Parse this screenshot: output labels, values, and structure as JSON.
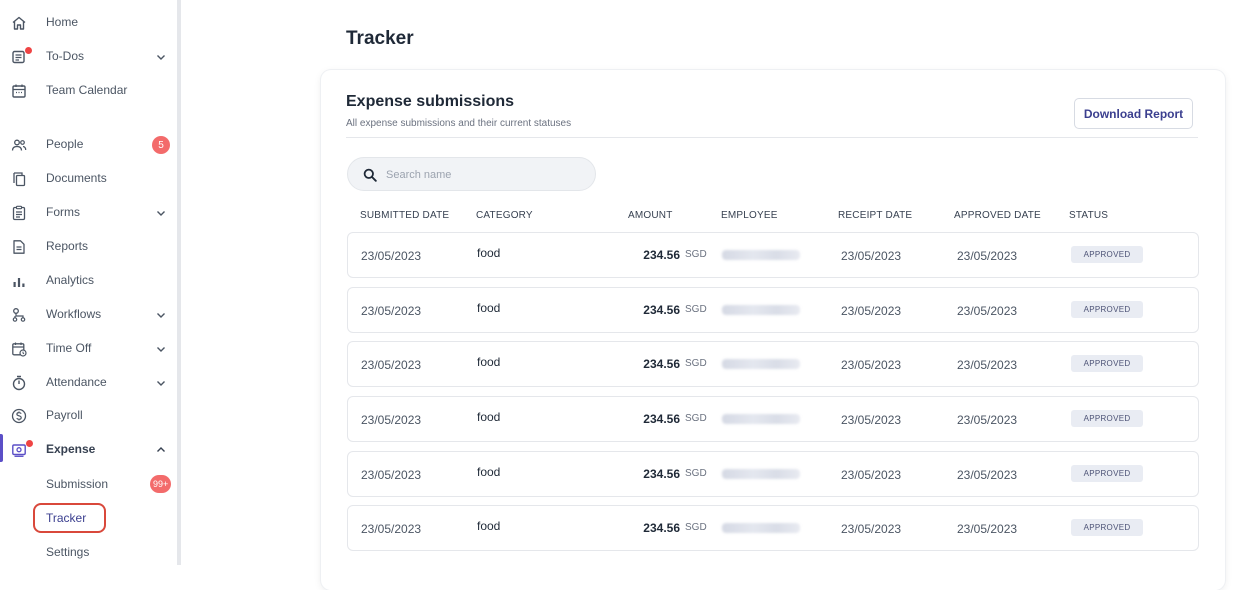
{
  "sidebar": {
    "items": [
      {
        "label": "Home",
        "icon": "home-icon"
      },
      {
        "label": "To-Dos",
        "icon": "todo-icon"
      },
      {
        "label": "Team Calendar",
        "icon": "calendar-icon"
      },
      {
        "label": "People",
        "icon": "people-icon",
        "badge": "5"
      },
      {
        "label": "Documents",
        "icon": "documents-icon"
      },
      {
        "label": "Forms",
        "icon": "forms-icon"
      },
      {
        "label": "Reports",
        "icon": "reports-icon"
      },
      {
        "label": "Analytics",
        "icon": "analytics-icon"
      },
      {
        "label": "Workflows",
        "icon": "workflows-icon"
      },
      {
        "label": "Time Off",
        "icon": "time-off-icon"
      },
      {
        "label": "Attendance",
        "icon": "stopwatch-icon"
      },
      {
        "label": "Payroll",
        "icon": "dollar-icon"
      },
      {
        "label": "Expense",
        "icon": "expense-icon"
      }
    ],
    "expense_sub": {
      "submission": "Submission",
      "submission_badge": "99+",
      "tracker": "Tracker",
      "settings": "Settings"
    }
  },
  "page": {
    "title": "Tracker"
  },
  "card": {
    "title": "Expense submissions",
    "subtitle": "All expense submissions and their current statuses",
    "download_label": "Download Report"
  },
  "search": {
    "placeholder": "Search name"
  },
  "table": {
    "headers": {
      "submitted_date": "SUBMITTED DATE",
      "category": "CATEGORY",
      "amount": "AMOUNT",
      "employee": "EMPLOYEE",
      "receipt_date": "RECEIPT DATE",
      "approved_date": "APPROVED DATE",
      "status": "STATUS"
    },
    "rows": [
      {
        "submitted": "23/05/2023",
        "category": "food",
        "amount": "234.56",
        "currency": "SGD",
        "receipt": "23/05/2023",
        "approved": "23/05/2023",
        "status": "APPROVED"
      },
      {
        "submitted": "23/05/2023",
        "category": "food",
        "amount": "234.56",
        "currency": "SGD",
        "receipt": "23/05/2023",
        "approved": "23/05/2023",
        "status": "APPROVED"
      },
      {
        "submitted": "23/05/2023",
        "category": "food",
        "amount": "234.56",
        "currency": "SGD",
        "receipt": "23/05/2023",
        "approved": "23/05/2023",
        "status": "APPROVED"
      },
      {
        "submitted": "23/05/2023",
        "category": "food",
        "amount": "234.56",
        "currency": "SGD",
        "receipt": "23/05/2023",
        "approved": "23/05/2023",
        "status": "APPROVED"
      },
      {
        "submitted": "23/05/2023",
        "category": "food",
        "amount": "234.56",
        "currency": "SGD",
        "receipt": "23/05/2023",
        "approved": "23/05/2023",
        "status": "APPROVED"
      },
      {
        "submitted": "23/05/2023",
        "category": "food",
        "amount": "234.56",
        "currency": "SGD",
        "receipt": "23/05/2023",
        "approved": "23/05/2023",
        "status": "APPROVED"
      }
    ]
  },
  "colors": {
    "accent": "#5b4fc7",
    "badge": "#f36b6b",
    "highlight_outline": "#d9483b",
    "status_bg": "#e9ecf3"
  }
}
